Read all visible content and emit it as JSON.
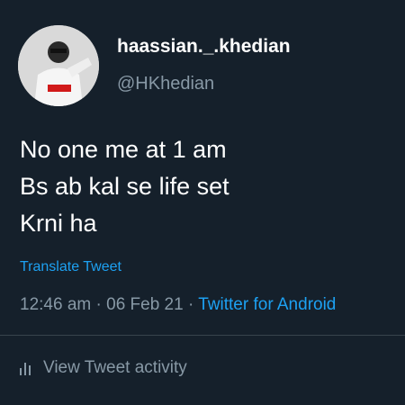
{
  "tweet": {
    "display_name": "haassian._.khedian",
    "handle": "@HKhedian",
    "text_lines": [
      "No one me at 1 am",
      "Bs ab kal se life set",
      "Krni ha"
    ],
    "translate_label": "Translate Tweet",
    "time": "12:46 am",
    "separator": " · ",
    "date": "06 Feb 21",
    "source": "Twitter for Android",
    "activity_label": "View Tweet activity"
  },
  "icons": {
    "activity": "bar-chart-icon"
  },
  "colors": {
    "background": "#15202b",
    "link": "#1da1f2",
    "secondary_text": "#8899a6",
    "divider": "#38444d"
  }
}
